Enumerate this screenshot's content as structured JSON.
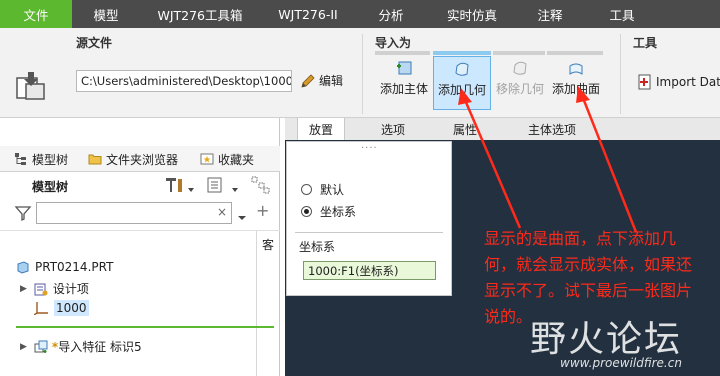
{
  "ribbon_tabs": [
    "文件",
    "模型",
    "WJT276工具箱",
    "WJT276-II",
    "分析",
    "实时仿真",
    "注释",
    "工具"
  ],
  "ribbon": {
    "source_group_title": "源文件",
    "source_path": "C:\\Users\\administered\\Desktop\\1000",
    "edit_label": "编辑",
    "import_as_title": "导入为",
    "buttons": {
      "add_body": "添加主体",
      "add_geometry": "添加几何",
      "remove_geometry": "移除几何",
      "add_surface": "添加曲面"
    },
    "tools_title": "工具",
    "import_data": "Import Dat"
  },
  "sub_tabs": [
    "放置",
    "选项",
    "属性",
    "主体选项"
  ],
  "left_panel": {
    "tabs": [
      "模型树",
      "文件夹浏览器",
      "收藏夹"
    ],
    "tree_title": "模型树",
    "column_header": "客",
    "tree": {
      "root": "PRT0214.PRT",
      "design_item": "设计项",
      "csys": "1000",
      "feature": "导入特征 标识5",
      "feature_mark": "*"
    }
  },
  "placement": {
    "option_default": "默认",
    "option_csys": "坐标系",
    "csys_label": "坐标系",
    "csys_value": "1000:F1(坐标系)"
  },
  "annotation": "显示的是曲面，点下添加几何，就会显示成实体，如果还显示不了。试下最后一张图片说的。",
  "watermark": {
    "cn": "野火论坛",
    "url": "www.proewildfire.cn"
  },
  "colors": {
    "file_tab": "#5cb82e",
    "tab_bar": "#4b4b4b",
    "dashboard": "#22303f",
    "annotation": "#ff2a1a",
    "csys_field_bg": "#e8f8d8"
  }
}
